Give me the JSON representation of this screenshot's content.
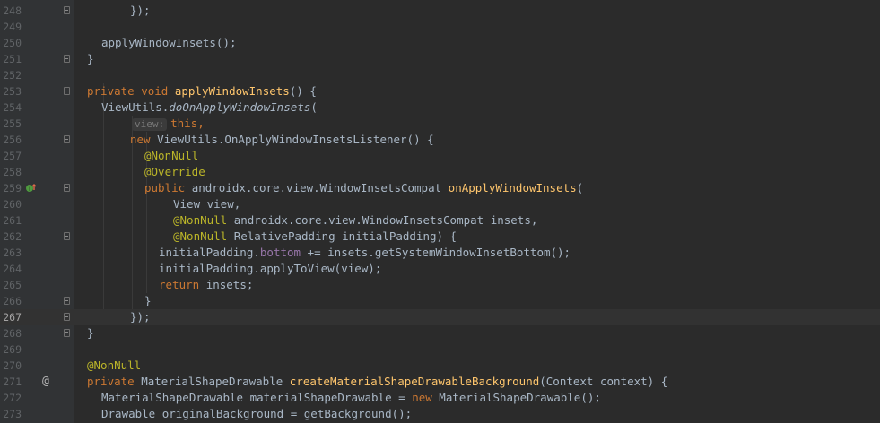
{
  "editor": {
    "current_line": "267",
    "lines": [
      {
        "n": "248",
        "segs": [
          {
            "t": "});",
            "c": ""
          }
        ]
      },
      {
        "n": "249",
        "segs": []
      },
      {
        "n": "250",
        "segs": [
          {
            "t": "applyWindowInsets();",
            "c": ""
          }
        ]
      },
      {
        "n": "251",
        "segs": [
          {
            "t": "}",
            "c": ""
          }
        ]
      },
      {
        "n": "252",
        "segs": []
      },
      {
        "n": "253",
        "segs": [
          {
            "t": "private ",
            "c": "kw"
          },
          {
            "t": "void ",
            "c": "kw"
          },
          {
            "t": "applyWindowInsets",
            "c": "fn"
          },
          {
            "t": "() {",
            "c": ""
          }
        ]
      },
      {
        "n": "254",
        "segs": [
          {
            "t": "ViewUtils.",
            "c": ""
          },
          {
            "t": "doOnApplyWindowInsets",
            "c": "it"
          },
          {
            "t": "(",
            "c": ""
          }
        ]
      },
      {
        "n": "255",
        "segs": [
          {
            "t": "view:",
            "c": "hint"
          },
          {
            "t": "this,",
            "c": "kw"
          }
        ]
      },
      {
        "n": "256",
        "segs": [
          {
            "t": "new ",
            "c": "kw"
          },
          {
            "t": "ViewUtils.OnApplyWindowInsetsListener() {",
            "c": ""
          }
        ]
      },
      {
        "n": "257",
        "segs": [
          {
            "t": "@NonNull",
            "c": "ann"
          }
        ]
      },
      {
        "n": "258",
        "segs": [
          {
            "t": "@Override",
            "c": "ann"
          }
        ]
      },
      {
        "n": "259",
        "segs": [
          {
            "t": "public ",
            "c": "kw"
          },
          {
            "t": "androidx.core.view.WindowInsetsCompat ",
            "c": ""
          },
          {
            "t": "onApplyWindowInsets",
            "c": "fn"
          },
          {
            "t": "(",
            "c": ""
          }
        ]
      },
      {
        "n": "260",
        "segs": [
          {
            "t": "View view,",
            "c": ""
          }
        ]
      },
      {
        "n": "261",
        "segs": [
          {
            "t": "@NonNull ",
            "c": "ann"
          },
          {
            "t": "androidx.core.view.WindowInsetsCompat insets,",
            "c": ""
          }
        ]
      },
      {
        "n": "262",
        "segs": [
          {
            "t": "@NonNull ",
            "c": "ann"
          },
          {
            "t": "RelativePadding initialPadding) {",
            "c": ""
          }
        ]
      },
      {
        "n": "263",
        "segs": [
          {
            "t": "initialPadding.",
            "c": ""
          },
          {
            "t": "bottom",
            "c": "fld"
          },
          {
            "t": " += insets.getSystemWindowInsetBottom();",
            "c": ""
          }
        ]
      },
      {
        "n": "264",
        "segs": [
          {
            "t": "initialPadding.applyToView(view);",
            "c": ""
          }
        ]
      },
      {
        "n": "265",
        "segs": [
          {
            "t": "return ",
            "c": "kw"
          },
          {
            "t": "insets;",
            "c": ""
          }
        ]
      },
      {
        "n": "266",
        "segs": [
          {
            "t": "}",
            "c": ""
          }
        ]
      },
      {
        "n": "267",
        "segs": [
          {
            "t": "});",
            "c": ""
          }
        ]
      },
      {
        "n": "268",
        "segs": [
          {
            "t": "}",
            "c": ""
          }
        ]
      },
      {
        "n": "269",
        "segs": []
      },
      {
        "n": "270",
        "segs": [
          {
            "t": "@NonNull",
            "c": "ann"
          }
        ]
      },
      {
        "n": "271",
        "segs": [
          {
            "t": "private ",
            "c": "kw"
          },
          {
            "t": "MaterialShapeDrawable ",
            "c": ""
          },
          {
            "t": "createMaterialShapeDrawableBackground",
            "c": "fn"
          },
          {
            "t": "(Context context) {",
            "c": ""
          }
        ]
      },
      {
        "n": "272",
        "segs": [
          {
            "t": "MaterialShapeDrawable materialShapeDrawable = ",
            "c": ""
          },
          {
            "t": "new ",
            "c": "kw"
          },
          {
            "t": "MaterialShapeDrawable();",
            "c": ""
          }
        ]
      },
      {
        "n": "273",
        "segs": [
          {
            "t": "Drawable originalBackground = getBackground();",
            "c": ""
          }
        ]
      }
    ]
  },
  "gutter_icons": {
    "override_icon": "override-implementing-method-icon",
    "at_icon": "@"
  },
  "colors": {
    "background": "#2b2b2b",
    "gutter": "#313335",
    "keyword": "#cc7832",
    "function": "#ffc66d",
    "annotation": "#bbb529",
    "field": "#9876aa",
    "text": "#a9b7c6"
  }
}
